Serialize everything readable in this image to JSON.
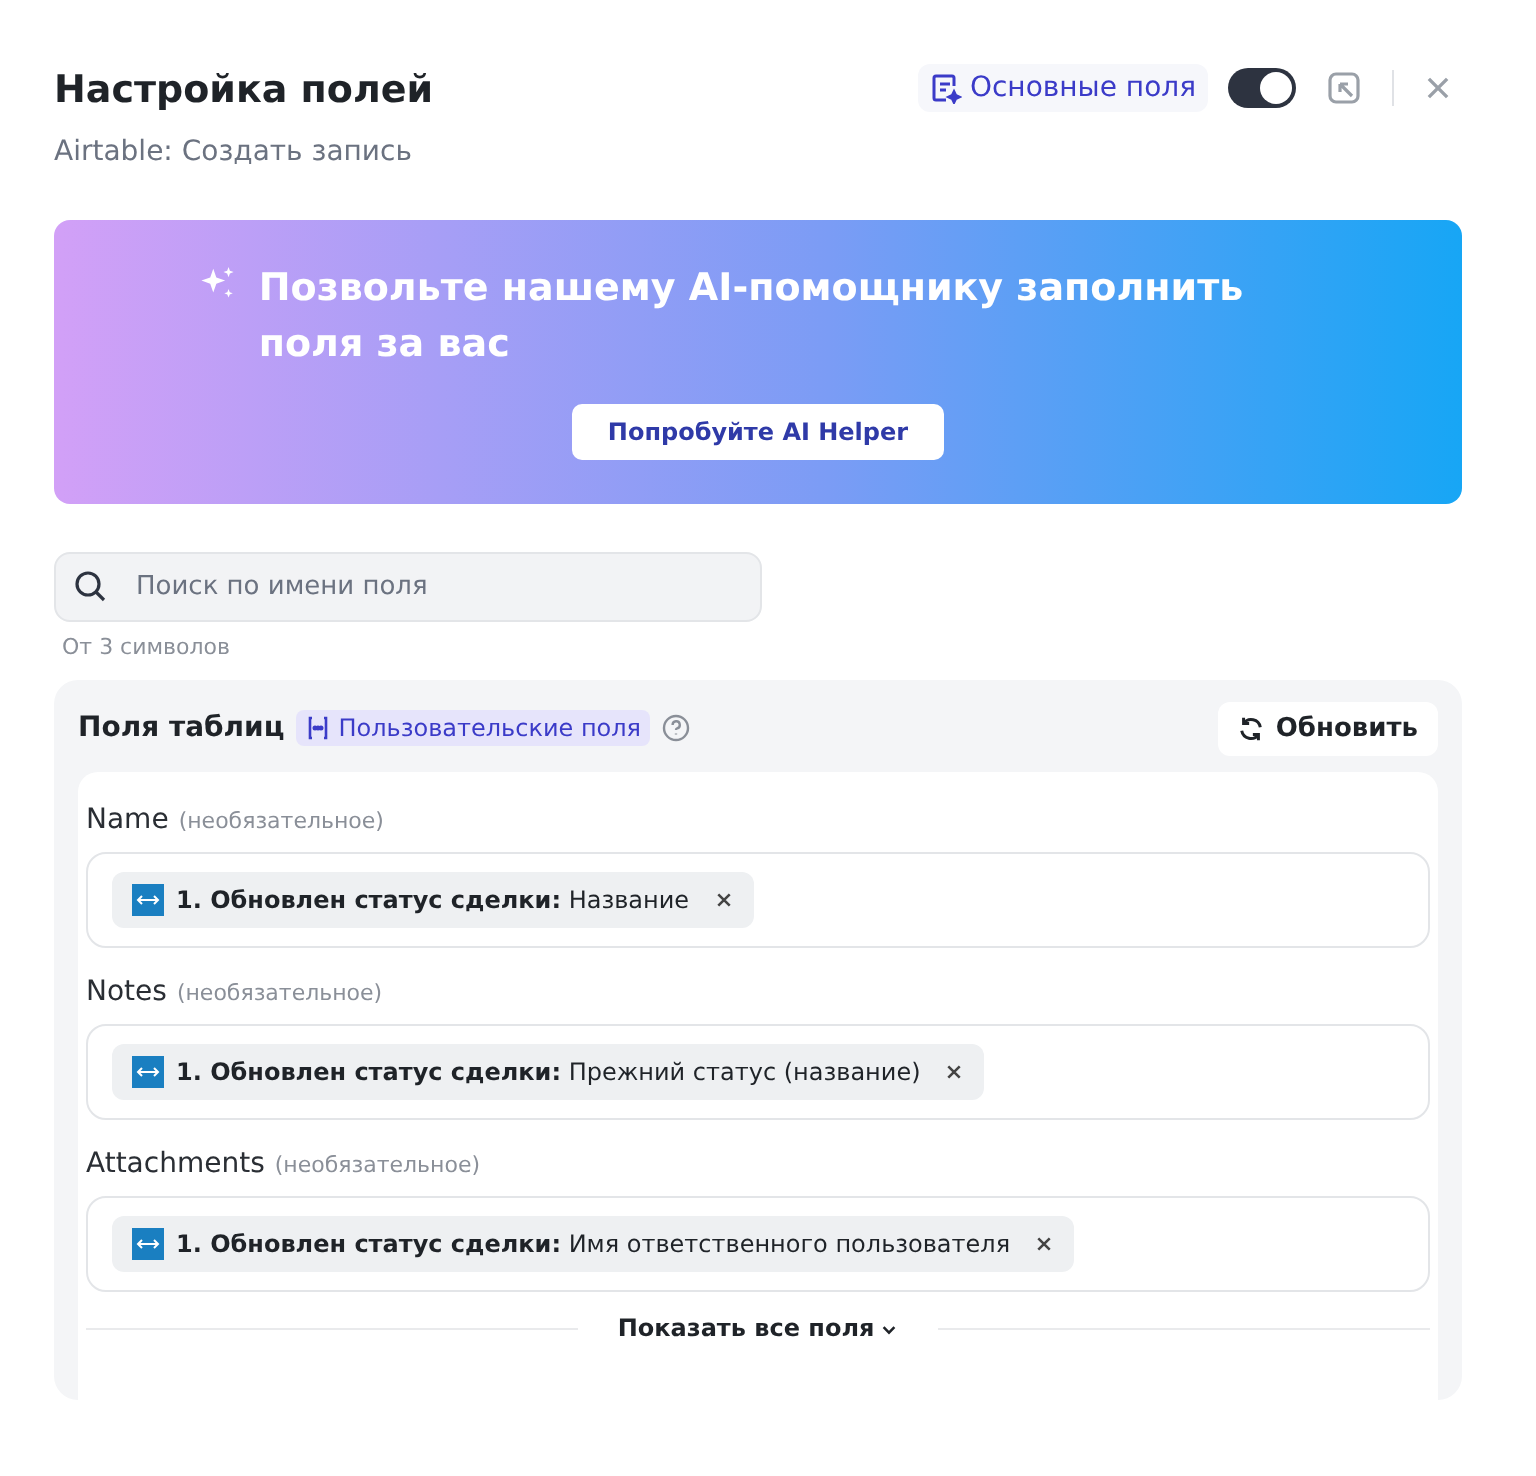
{
  "header": {
    "title": "Настройка полей",
    "subtitle": "Airtable: Создать запись",
    "mode_label": "Основные поля",
    "mode_toggle": {
      "on": true
    }
  },
  "banner": {
    "text": "Позвольте нашему AI-помощнику заполнить поля за вас",
    "button": "Попробуйте AI Helper"
  },
  "search": {
    "placeholder": "Поиск по имени поля",
    "hint": "От 3 символов"
  },
  "panel": {
    "title": "Поля таблиц",
    "tag": "Пользовательские поля",
    "refresh": "Обновить",
    "fields": [
      {
        "name": "Name",
        "optional": "(необязательное)",
        "chips": [
          "**1. Обновлен статус сделки:** Название"
        ]
      },
      {
        "name": "Notes",
        "optional": "(необязательное)",
        "chips": [
          "**1. Обновлен статус сделки:** Прежний статус (название)"
        ]
      },
      {
        "name": "Attachments",
        "optional": "(необязательное)",
        "chips": [
          "**1. Обновлен статус сделки:** Имя ответственного пользователя"
        ]
      }
    ],
    "show_all": "Показать все поля"
  }
}
